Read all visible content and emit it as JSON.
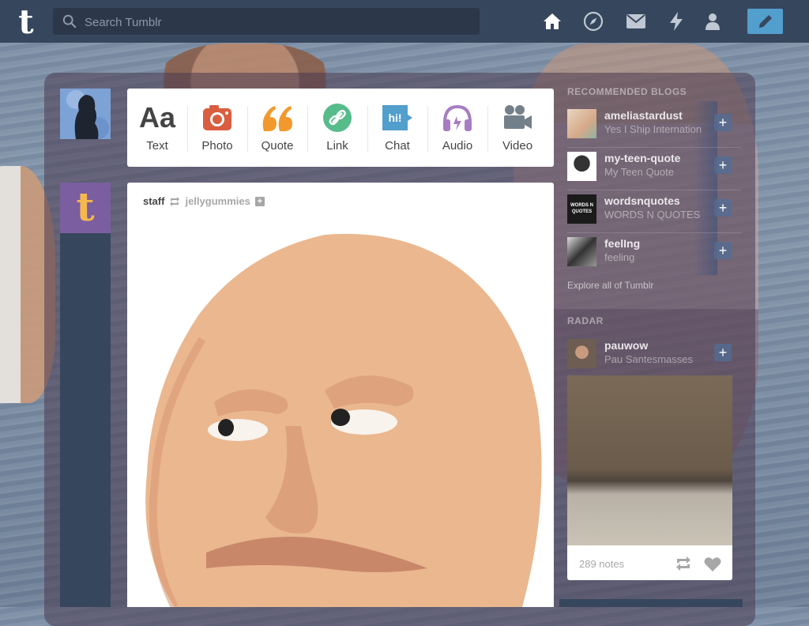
{
  "header": {
    "search_placeholder": "Search Tumblr",
    "logo_letter": "t",
    "nav": [
      {
        "name": "home-icon"
      },
      {
        "name": "explore-icon"
      },
      {
        "name": "messages-icon"
      },
      {
        "name": "activity-icon"
      },
      {
        "name": "account-icon"
      }
    ],
    "compose_icon": "pencil-icon"
  },
  "composer": {
    "types": [
      {
        "label": "Text",
        "icon": "text-icon",
        "color": "#444444"
      },
      {
        "label": "Photo",
        "icon": "camera-icon",
        "color": "#d95e40"
      },
      {
        "label": "Quote",
        "icon": "quote-icon",
        "color": "#f2992e"
      },
      {
        "label": "Link",
        "icon": "link-icon",
        "color": "#56bc8a"
      },
      {
        "label": "Chat",
        "icon": "chat-icon",
        "color": "#529ecc"
      },
      {
        "label": "Audio",
        "icon": "headphones-icon",
        "color": "#a77dc2"
      },
      {
        "label": "Video",
        "icon": "video-camera-icon",
        "color": "#748089"
      }
    ],
    "text_glyph": "Aa",
    "chat_glyph": "hi!"
  },
  "post": {
    "author": "staff",
    "reblogged_from": "jellygummies"
  },
  "sidebar": {
    "recommended_title": "RECOMMENDED BLOGS",
    "blogs": [
      {
        "name": "ameliastardust",
        "title": "Yes I Ship Internation"
      },
      {
        "name": "my-teen-quote",
        "title": "My Teen Quote"
      },
      {
        "name": "wordsnquotes",
        "title": "WORDS N QUOTES",
        "avatar_text": "WORDS N QUOTES"
      },
      {
        "name": "feelIng",
        "title": "feeling"
      }
    ],
    "explore_link": "Explore all of Tumblr",
    "radar_title": "RADAR",
    "radar_blog": {
      "name": "pauwow",
      "title": "Pau Santesmasses"
    },
    "radar_notes": "289 notes"
  },
  "colors": {
    "topbar": "#36465d",
    "accent": "#529ecc"
  }
}
